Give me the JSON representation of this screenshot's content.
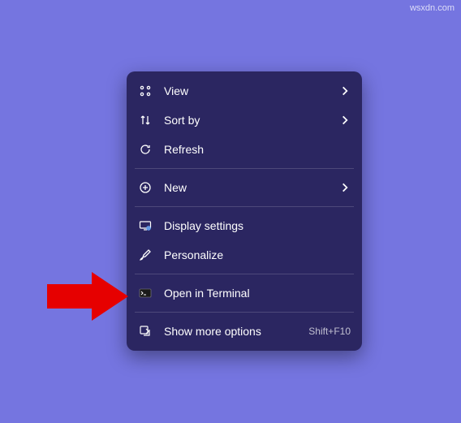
{
  "watermark": "wsxdn.com",
  "menu": {
    "groups": [
      [
        {
          "icon": "grid-icon",
          "label": "View",
          "submenu": true
        },
        {
          "icon": "sort-icon",
          "label": "Sort by",
          "submenu": true
        },
        {
          "icon": "refresh-icon",
          "label": "Refresh"
        }
      ],
      [
        {
          "icon": "plus-circle-icon",
          "label": "New",
          "submenu": true
        }
      ],
      [
        {
          "icon": "display-settings-icon",
          "label": "Display settings"
        },
        {
          "icon": "brush-icon",
          "label": "Personalize"
        }
      ],
      [
        {
          "icon": "terminal-icon",
          "label": "Open in Terminal"
        }
      ],
      [
        {
          "icon": "more-options-icon",
          "label": "Show more options",
          "shortcut": "Shift+F10"
        }
      ]
    ]
  },
  "colors": {
    "background": "#7575e0",
    "menu_bg": "#2b2661",
    "accent_arrow": "#e60000"
  }
}
